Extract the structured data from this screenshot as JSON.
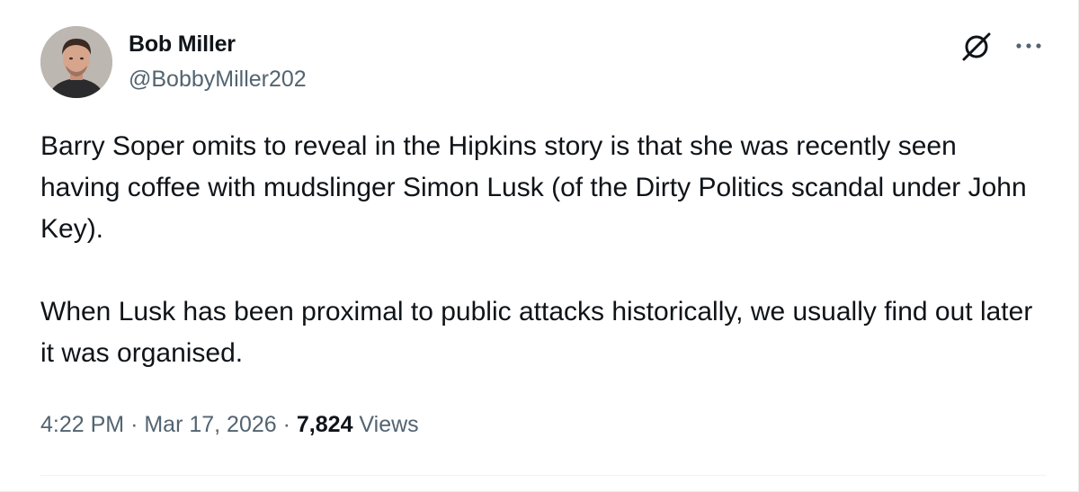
{
  "author": {
    "display_name": "Bob Miller",
    "handle": "@BobbyMiller202"
  },
  "tweet": {
    "paragraphs": [
      "Barry Soper omits to reveal in the Hipkins story is that she was recently seen having coffee with mudslinger Simon Lusk (of the Dirty Politics scandal under John Key).",
      "When Lusk has been proximal to public attacks historically, we usually find out later it was organised."
    ]
  },
  "meta": {
    "time": "4:22 PM",
    "separator": "·",
    "date": "Mar 17, 2026",
    "views_count": "7,824",
    "views_label": "Views"
  },
  "icons": {
    "grok": "grok-icon",
    "more": "more-icon"
  },
  "colors": {
    "text_primary": "#0f1419",
    "text_secondary": "#536471",
    "background": "#ffffff",
    "divider": "#eff3f4"
  }
}
